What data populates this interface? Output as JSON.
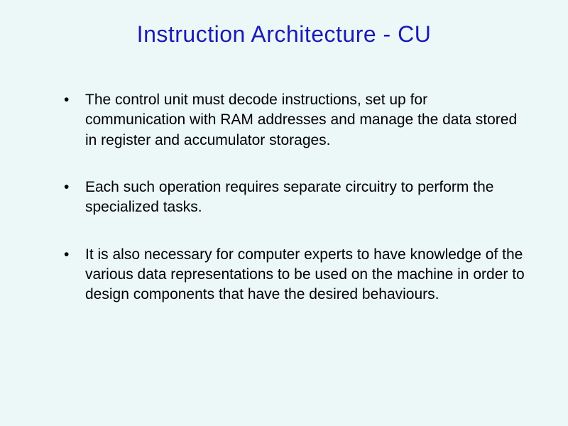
{
  "slide": {
    "title": "Instruction Architecture - CU",
    "bullets": [
      "The control unit must decode instructions, set up for communication with RAM addresses and manage the data stored in register and accumulator storages.",
      "Each such operation requires separate circuitry to perform the specialized tasks.",
      "It is also necessary for computer experts to have knowledge of the various data representations to be used on the machine in order to design components that have the desired behaviours."
    ]
  }
}
